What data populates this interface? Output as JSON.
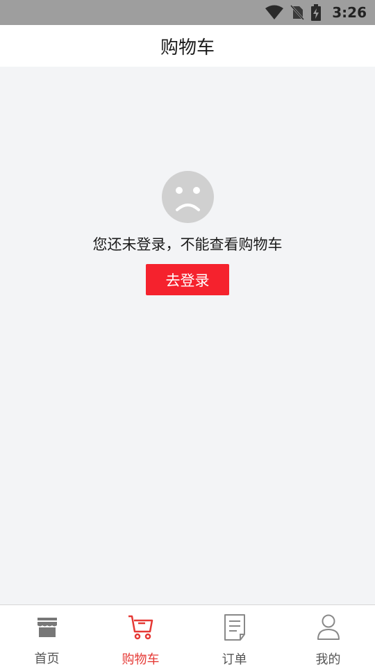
{
  "status_bar": {
    "time": "3:26",
    "icons": [
      "wifi-icon",
      "no-sim-icon",
      "battery-charging-icon"
    ]
  },
  "header": {
    "title": "购物车"
  },
  "empty_state": {
    "icon": "sad-face-icon",
    "message": "您还未登录，不能查看购物车",
    "login_button_label": "去登录"
  },
  "tab_bar": {
    "active_index": 1,
    "items": [
      {
        "label": "首页",
        "icon": "store-icon"
      },
      {
        "label": "购物车",
        "icon": "cart-icon"
      },
      {
        "label": "订单",
        "icon": "order-list-icon"
      },
      {
        "label": "我的",
        "icon": "user-icon"
      }
    ]
  },
  "colors": {
    "accent": "#f5222d",
    "active_tab": "#e53935",
    "inactive_tab": "#555555",
    "status_bar": "#9e9e9e",
    "background": "#f3f4f6"
  }
}
